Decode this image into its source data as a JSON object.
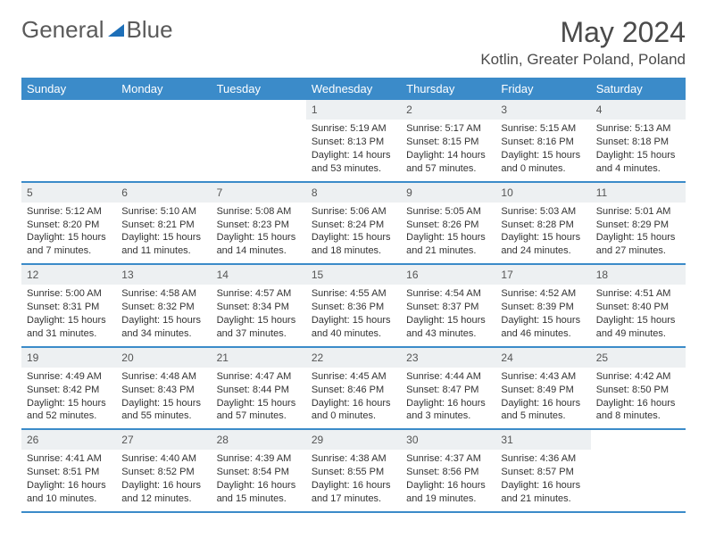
{
  "brand": {
    "part1": "General",
    "part2": "Blue"
  },
  "title": "May 2024",
  "location": "Kotlin, Greater Poland, Poland",
  "weekdays": [
    "Sunday",
    "Monday",
    "Tuesday",
    "Wednesday",
    "Thursday",
    "Friday",
    "Saturday"
  ],
  "labels": {
    "sunrise": "Sunrise:",
    "sunset": "Sunset:",
    "daylight": "Daylight:"
  },
  "weeks": [
    [
      null,
      null,
      null,
      {
        "d": "1",
        "sr": "5:19 AM",
        "ss": "8:13 PM",
        "dl": "14 hours and 53 minutes."
      },
      {
        "d": "2",
        "sr": "5:17 AM",
        "ss": "8:15 PM",
        "dl": "14 hours and 57 minutes."
      },
      {
        "d": "3",
        "sr": "5:15 AM",
        "ss": "8:16 PM",
        "dl": "15 hours and 0 minutes."
      },
      {
        "d": "4",
        "sr": "5:13 AM",
        "ss": "8:18 PM",
        "dl": "15 hours and 4 minutes."
      }
    ],
    [
      {
        "d": "5",
        "sr": "5:12 AM",
        "ss": "8:20 PM",
        "dl": "15 hours and 7 minutes."
      },
      {
        "d": "6",
        "sr": "5:10 AM",
        "ss": "8:21 PM",
        "dl": "15 hours and 11 minutes."
      },
      {
        "d": "7",
        "sr": "5:08 AM",
        "ss": "8:23 PM",
        "dl": "15 hours and 14 minutes."
      },
      {
        "d": "8",
        "sr": "5:06 AM",
        "ss": "8:24 PM",
        "dl": "15 hours and 18 minutes."
      },
      {
        "d": "9",
        "sr": "5:05 AM",
        "ss": "8:26 PM",
        "dl": "15 hours and 21 minutes."
      },
      {
        "d": "10",
        "sr": "5:03 AM",
        "ss": "8:28 PM",
        "dl": "15 hours and 24 minutes."
      },
      {
        "d": "11",
        "sr": "5:01 AM",
        "ss": "8:29 PM",
        "dl": "15 hours and 27 minutes."
      }
    ],
    [
      {
        "d": "12",
        "sr": "5:00 AM",
        "ss": "8:31 PM",
        "dl": "15 hours and 31 minutes."
      },
      {
        "d": "13",
        "sr": "4:58 AM",
        "ss": "8:32 PM",
        "dl": "15 hours and 34 minutes."
      },
      {
        "d": "14",
        "sr": "4:57 AM",
        "ss": "8:34 PM",
        "dl": "15 hours and 37 minutes."
      },
      {
        "d": "15",
        "sr": "4:55 AM",
        "ss": "8:36 PM",
        "dl": "15 hours and 40 minutes."
      },
      {
        "d": "16",
        "sr": "4:54 AM",
        "ss": "8:37 PM",
        "dl": "15 hours and 43 minutes."
      },
      {
        "d": "17",
        "sr": "4:52 AM",
        "ss": "8:39 PM",
        "dl": "15 hours and 46 minutes."
      },
      {
        "d": "18",
        "sr": "4:51 AM",
        "ss": "8:40 PM",
        "dl": "15 hours and 49 minutes."
      }
    ],
    [
      {
        "d": "19",
        "sr": "4:49 AM",
        "ss": "8:42 PM",
        "dl": "15 hours and 52 minutes."
      },
      {
        "d": "20",
        "sr": "4:48 AM",
        "ss": "8:43 PM",
        "dl": "15 hours and 55 minutes."
      },
      {
        "d": "21",
        "sr": "4:47 AM",
        "ss": "8:44 PM",
        "dl": "15 hours and 57 minutes."
      },
      {
        "d": "22",
        "sr": "4:45 AM",
        "ss": "8:46 PM",
        "dl": "16 hours and 0 minutes."
      },
      {
        "d": "23",
        "sr": "4:44 AM",
        "ss": "8:47 PM",
        "dl": "16 hours and 3 minutes."
      },
      {
        "d": "24",
        "sr": "4:43 AM",
        "ss": "8:49 PM",
        "dl": "16 hours and 5 minutes."
      },
      {
        "d": "25",
        "sr": "4:42 AM",
        "ss": "8:50 PM",
        "dl": "16 hours and 8 minutes."
      }
    ],
    [
      {
        "d": "26",
        "sr": "4:41 AM",
        "ss": "8:51 PM",
        "dl": "16 hours and 10 minutes."
      },
      {
        "d": "27",
        "sr": "4:40 AM",
        "ss": "8:52 PM",
        "dl": "16 hours and 12 minutes."
      },
      {
        "d": "28",
        "sr": "4:39 AM",
        "ss": "8:54 PM",
        "dl": "16 hours and 15 minutes."
      },
      {
        "d": "29",
        "sr": "4:38 AM",
        "ss": "8:55 PM",
        "dl": "16 hours and 17 minutes."
      },
      {
        "d": "30",
        "sr": "4:37 AM",
        "ss": "8:56 PM",
        "dl": "16 hours and 19 minutes."
      },
      {
        "d": "31",
        "sr": "4:36 AM",
        "ss": "8:57 PM",
        "dl": "16 hours and 21 minutes."
      },
      null
    ]
  ]
}
